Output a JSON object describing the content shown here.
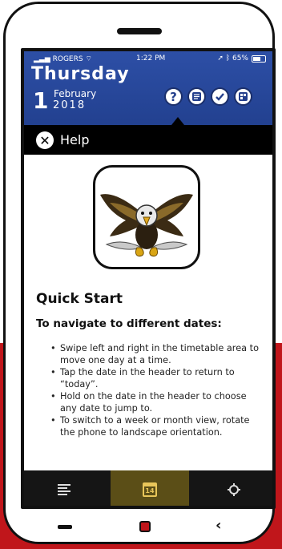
{
  "status": {
    "carrier": "ROGERS",
    "time": "1:22 PM",
    "battery": "65%"
  },
  "header": {
    "weekday": "Thursday",
    "day": "1",
    "month": "February",
    "year": "2018",
    "icons": [
      "help-icon",
      "notes-icon",
      "check-icon",
      "timetable-icon"
    ]
  },
  "help_bar": {
    "title": "Help",
    "close_icon": "close-icon"
  },
  "content": {
    "logo": "eagle-logo",
    "quick_start": "Quick Start",
    "navigate_heading": "To navigate to different dates:",
    "bullets": [
      "Swipe left and right in the timetable area to move one day at a time.",
      "Tap the date in the header to return to “today”.",
      "Hold on the date in the header to choose any date to jump to.",
      "To switch to a week or month view, rotate the phone to landscape orientation."
    ]
  },
  "tabs": {
    "items": [
      "menu-icon",
      "calendar-icon",
      "gear-icon"
    ],
    "calendar_day": "14",
    "active": "calendar-icon"
  },
  "colors": {
    "header_blue": "#2d4fa6",
    "tab_active": "#5b4e17",
    "backdrop_red": "#c0161b"
  }
}
